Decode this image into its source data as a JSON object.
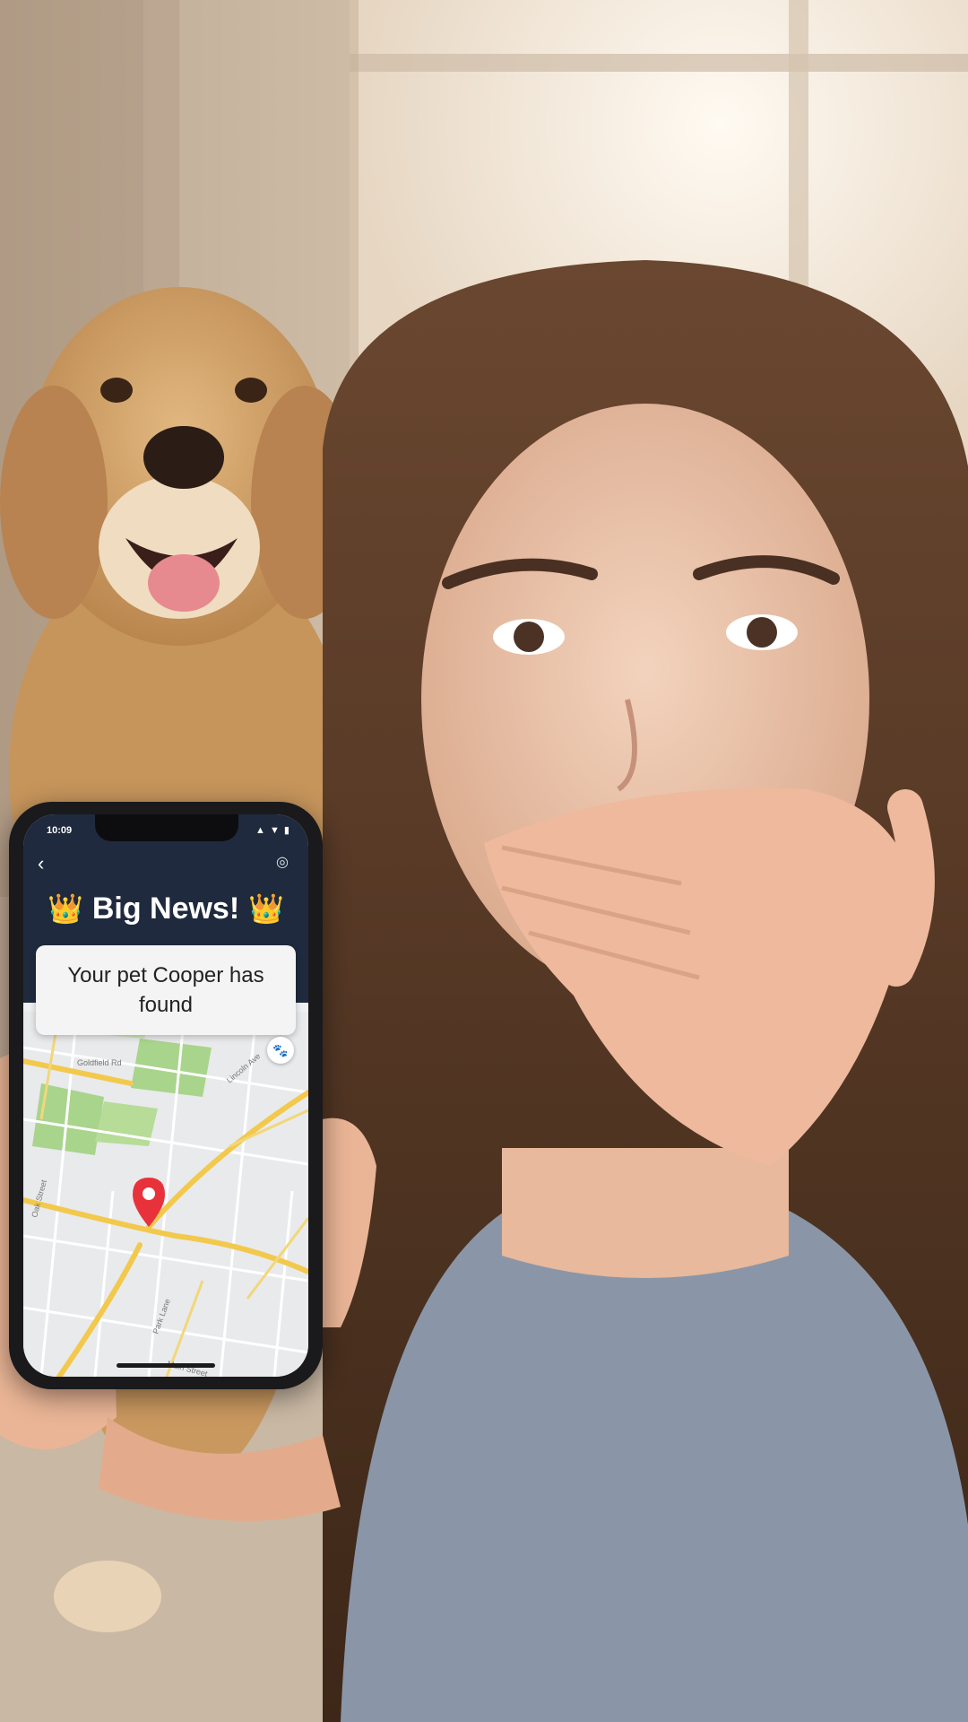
{
  "phone": {
    "status_time": "10:09",
    "status_icons": "▲ ▼ ▮",
    "back_icon": "chevron-left-icon",
    "settings_icon": "settings-icon",
    "title": "Big News!",
    "crown_emoji": "👑",
    "message": "Your pet Cooper has found",
    "pet_button_icon": "pet-icon",
    "accent_color": "#1f2a3e",
    "pin_color": "#e8323b"
  },
  "map": {
    "street_labels": [
      "Goldfield Rd",
      "Lincoln Ave",
      "Oak Street",
      "Park Lane",
      "Main Street"
    ]
  }
}
